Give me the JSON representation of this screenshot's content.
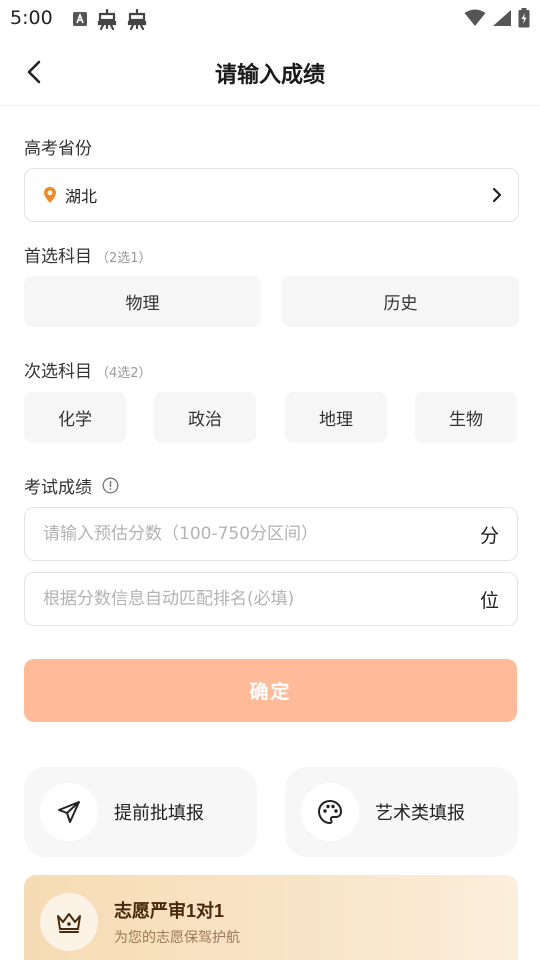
{
  "status_bar": {
    "time": "5:00",
    "icons": [
      "notification-a-icon",
      "bug-icon",
      "bug-icon",
      "wifi-icon",
      "signal-icon",
      "battery-charging-icon"
    ]
  },
  "nav": {
    "title": "请输入成绩",
    "back_icon": "chevron-left-icon"
  },
  "province": {
    "label": "高考省份",
    "value": "湖北",
    "icon": "location-pin-icon",
    "accent_color": "#f08a24"
  },
  "primary_subjects": {
    "label": "首选科目",
    "hint": "（2选1）",
    "options": [
      "物理",
      "历史"
    ]
  },
  "secondary_subjects": {
    "label": "次选科目",
    "hint": "（4选2）",
    "options": [
      "化学",
      "政治",
      "地理",
      "生物"
    ]
  },
  "exam_score": {
    "label": "考试成绩",
    "info_icon": "info-circle-icon",
    "score_placeholder": "请输入预估分数（100-750分区间）",
    "score_unit": "分",
    "rank_placeholder": "根据分数信息自动匹配排名(必填)",
    "rank_unit": "位"
  },
  "confirm": {
    "label": "确定",
    "color": "#ffbb99"
  },
  "features": [
    {
      "label": "提前批填报",
      "icon": "send-arrow-icon"
    },
    {
      "label": "艺术类填报",
      "icon": "palette-icon"
    }
  ],
  "promo": {
    "title_part1": "志愿严审",
    "title_num1": "1",
    "title_part2": "对",
    "title_num2": "1",
    "subtitle": "为您的志愿保驾护航",
    "icon": "crown-icon"
  }
}
